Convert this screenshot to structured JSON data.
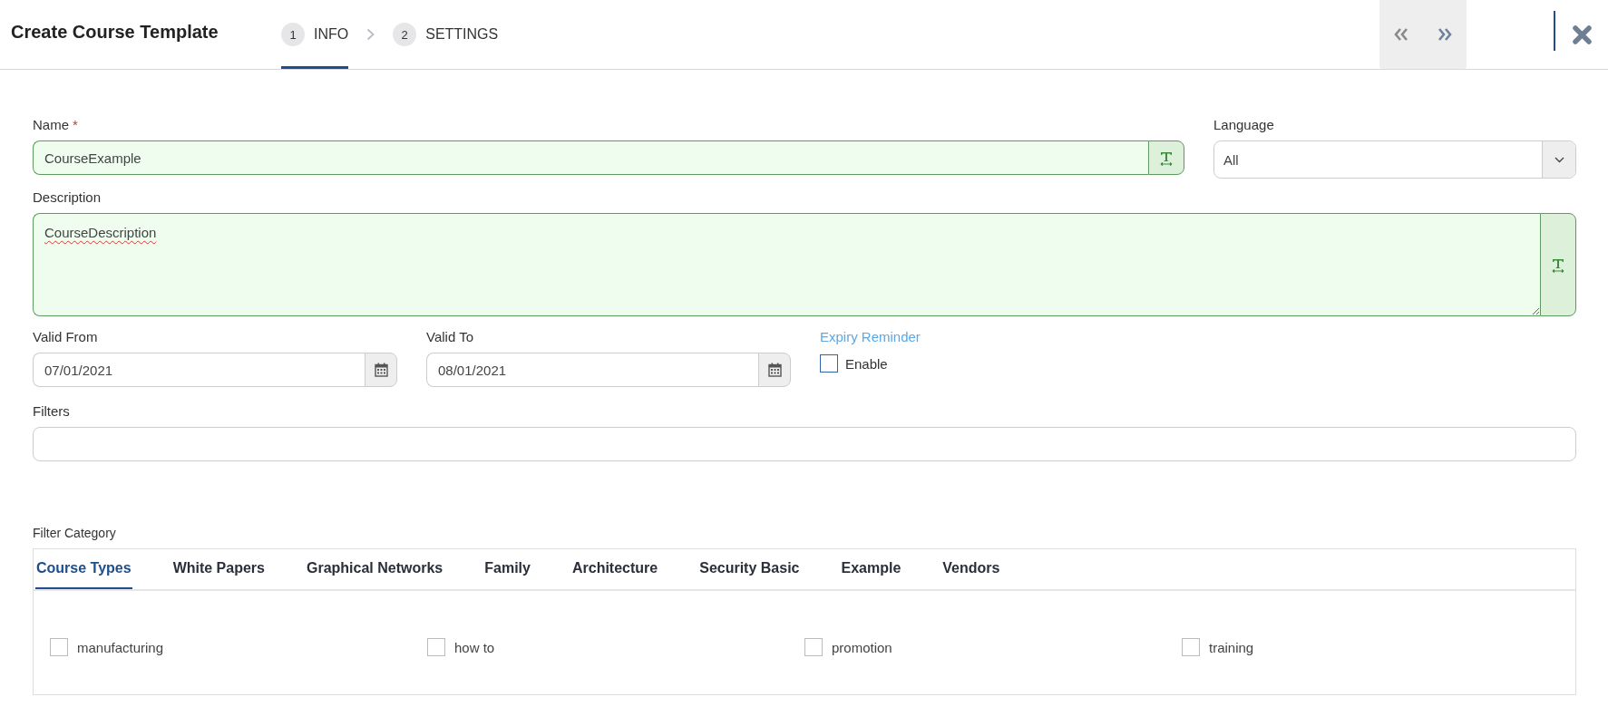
{
  "header": {
    "title": "Create Course Template",
    "steps": [
      {
        "number": "1",
        "label": "INFO",
        "selected": true
      },
      {
        "number": "2",
        "label": "SETTINGS",
        "selected": false
      }
    ]
  },
  "form": {
    "name": {
      "label": "Name",
      "required_mark": "*",
      "value": "CourseExample"
    },
    "language": {
      "label": "Language",
      "value": "All"
    },
    "description": {
      "label": "Description",
      "value": "CourseDescription"
    },
    "valid_from": {
      "label": "Valid From",
      "value": "07/01/2021"
    },
    "valid_to": {
      "label": "Valid To",
      "value": "08/01/2021"
    },
    "expiry_reminder": {
      "label": "Expiry Reminder",
      "option": "Enable",
      "checked": false
    },
    "filters": {
      "label": "Filters"
    }
  },
  "filter_category": {
    "label": "Filter Category",
    "tabs": [
      {
        "label": "Course Types",
        "selected": true
      },
      {
        "label": "White Papers",
        "selected": false
      },
      {
        "label": "Graphical Networks",
        "selected": false
      },
      {
        "label": "Family",
        "selected": false
      },
      {
        "label": "Architecture",
        "selected": false
      },
      {
        "label": "Security Basic",
        "selected": false
      },
      {
        "label": "Example",
        "selected": false
      },
      {
        "label": "Vendors",
        "selected": false
      }
    ],
    "options": [
      {
        "label": "manufacturing",
        "checked": false
      },
      {
        "label": "how to",
        "checked": false
      },
      {
        "label": "promotion",
        "checked": false
      },
      {
        "label": "training",
        "checked": false
      }
    ]
  }
}
